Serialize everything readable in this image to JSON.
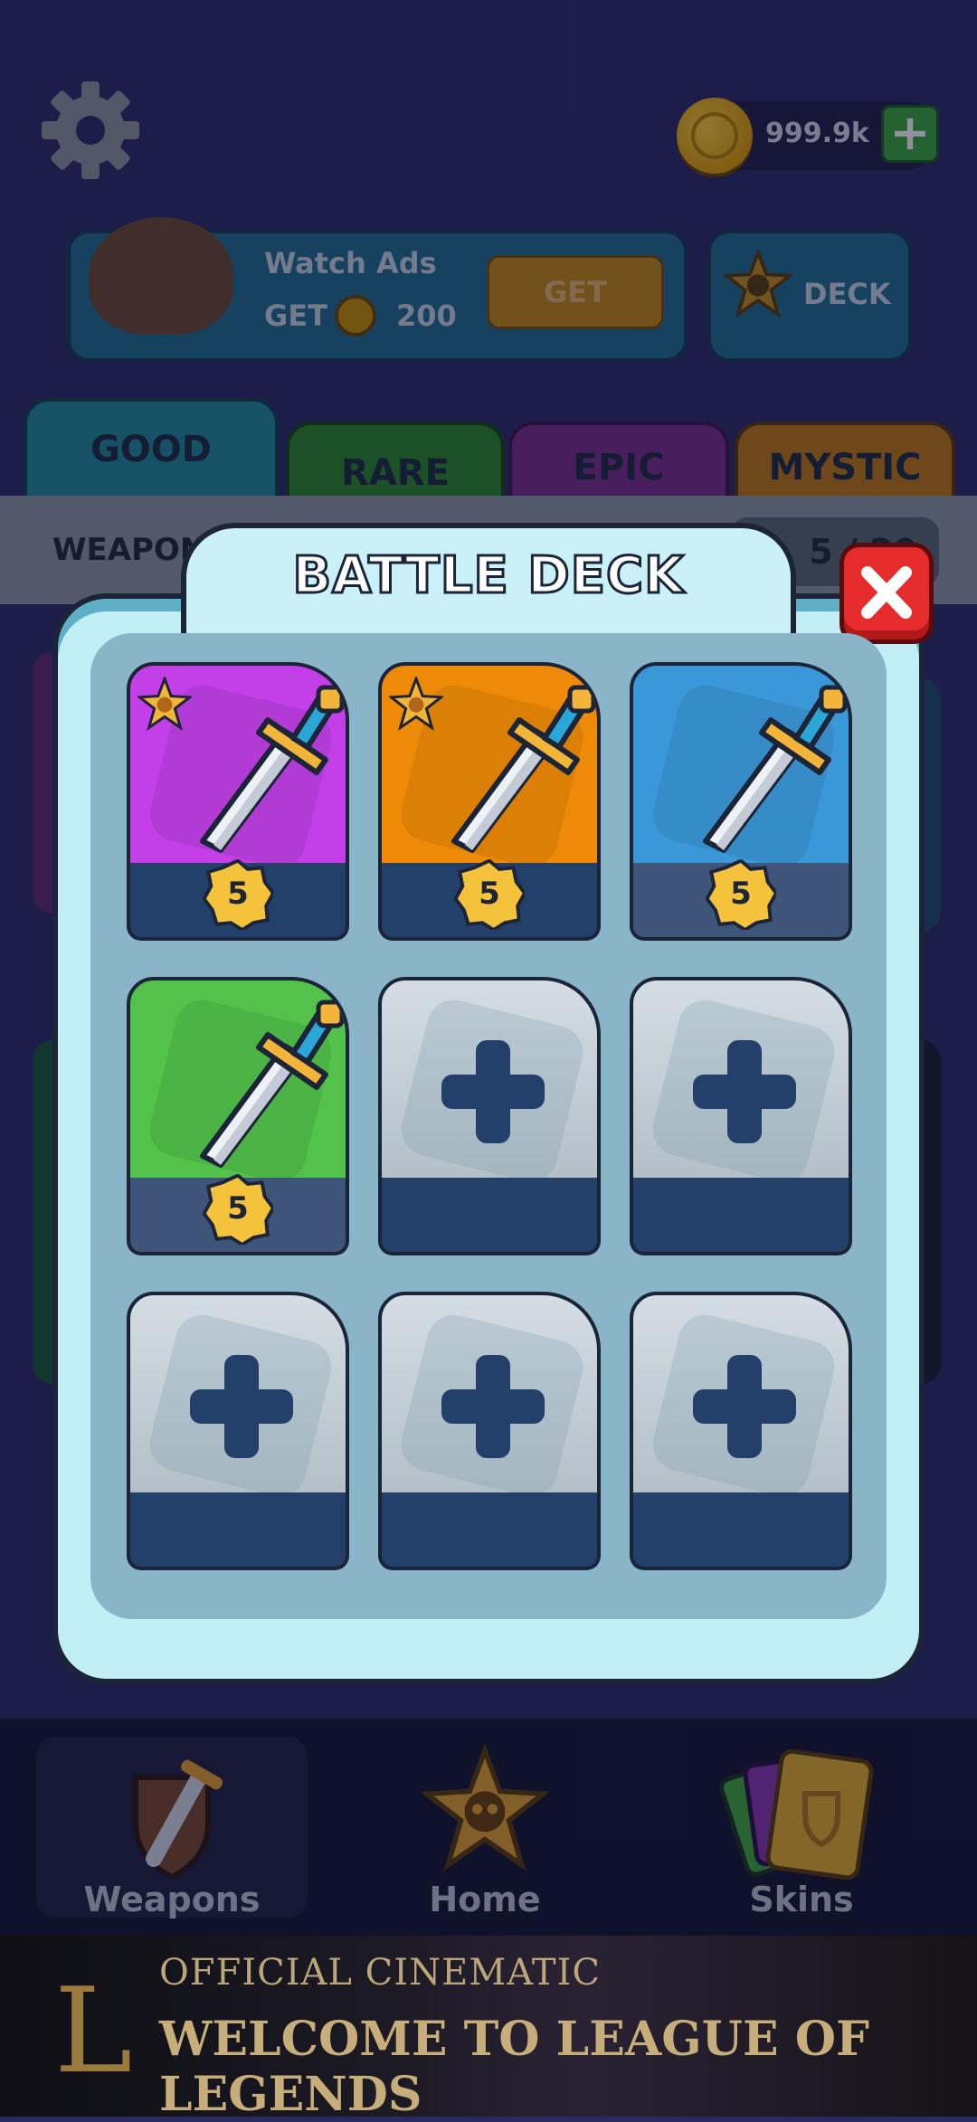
{
  "header": {
    "coin_amount": "999.9k",
    "coin_add_icon": "plus-icon",
    "settings_icon": "gear-icon"
  },
  "ads": {
    "title": "Watch Ads",
    "get_label": "GET",
    "reward_amount": "200",
    "button_label": "GET"
  },
  "deck_button": {
    "label": "DECK",
    "icon": "skull-star-icon"
  },
  "tabs": [
    {
      "label": "GOOD"
    },
    {
      "label": "RARE"
    },
    {
      "label": "EPIC"
    },
    {
      "label": "MYSTIC"
    }
  ],
  "weapons_strip": {
    "label": "WEAPON",
    "count": "5 / 20"
  },
  "modal": {
    "title": "BATTLE DECK",
    "close_icon": "close-icon",
    "slots": [
      {
        "type": "weapon",
        "rarity": "epic",
        "color": "#c340e8",
        "level": "5",
        "has_rank_star": true
      },
      {
        "type": "weapon",
        "rarity": "mystic",
        "color": "#ee8a08",
        "level": "5",
        "has_rank_star": true
      },
      {
        "type": "weapon",
        "rarity": "good",
        "color": "#3a98d8",
        "level": "5",
        "has_rank_star": false
      },
      {
        "type": "weapon",
        "rarity": "rare",
        "color": "#52c24a",
        "level": "5",
        "has_rank_star": false
      },
      {
        "type": "empty"
      },
      {
        "type": "empty"
      },
      {
        "type": "empty"
      },
      {
        "type": "empty"
      },
      {
        "type": "empty"
      }
    ]
  },
  "bottom_nav": [
    {
      "label": "Weapons",
      "icon": "sword-shield-icon",
      "active": true
    },
    {
      "label": "Home",
      "icon": "skull-star-icon",
      "active": false
    },
    {
      "label": "Skins",
      "icon": "cards-icon",
      "active": false
    }
  ],
  "banner": {
    "line1": "OFFICIAL CINEMATIC",
    "line2": "WELCOME TO LEAGUE OF LEGENDS",
    "logo_letter": "L"
  }
}
